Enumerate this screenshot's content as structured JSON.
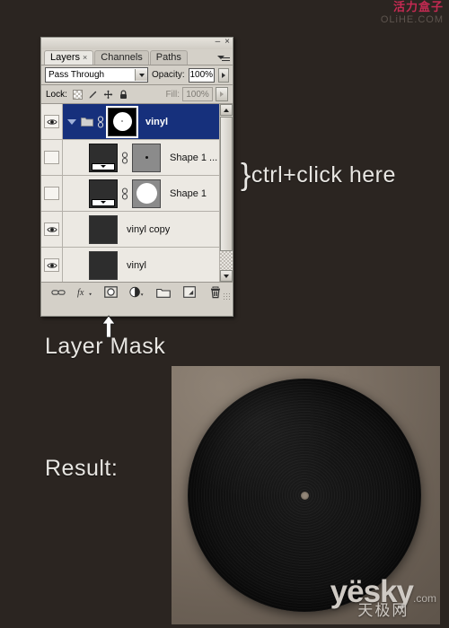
{
  "watermarks": {
    "top": {
      "cn": "活力盒子",
      "en": "OLiHE.COM"
    },
    "bottom": {
      "main": "yësky",
      "suffix": ".com",
      "cn": "天极网"
    }
  },
  "panel": {
    "window_controls": {
      "minimize": "–",
      "close": "×"
    },
    "menu_icon": "panel-menu-icon",
    "tabs": [
      {
        "label": "Layers",
        "close": "×",
        "active": true
      },
      {
        "label": "Channels",
        "active": false
      },
      {
        "label": "Paths",
        "active": false
      }
    ],
    "blend_mode": {
      "value": "Pass Through",
      "arrow": "▼"
    },
    "opacity": {
      "label": "Opacity:",
      "value": "100%",
      "stepper": "▶"
    },
    "lock": {
      "label": "Lock:",
      "icons": [
        "lock-transparency-icon",
        "lock-image-icon",
        "lock-position-icon",
        "lock-all-icon"
      ]
    },
    "fill": {
      "label": "Fill:",
      "value": "100%",
      "stepper": "▶"
    },
    "layers": [
      {
        "name": "vinyl",
        "visible": true,
        "selected": true,
        "type": "group",
        "expanded": true,
        "linked": true,
        "has_mask": true,
        "mask_selected": true
      },
      {
        "name": "Shape 1 ...",
        "visible": false,
        "selected": false,
        "type": "shape",
        "linked": true,
        "has_mask": true,
        "mask_kind": "dot"
      },
      {
        "name": "Shape 1",
        "visible": false,
        "selected": false,
        "type": "shape",
        "linked": true,
        "has_mask": true,
        "mask_kind": "circle"
      },
      {
        "name": "vinyl copy",
        "visible": true,
        "selected": false,
        "type": "raster",
        "linked": false,
        "has_mask": false
      },
      {
        "name": "vinyl",
        "visible": true,
        "selected": false,
        "type": "raster",
        "linked": false,
        "has_mask": false
      }
    ],
    "scrollbar": {
      "up": "▲",
      "down": "▼"
    },
    "toolbar": [
      {
        "name": "link-layers-icon",
        "glyph": "link"
      },
      {
        "name": "layer-style-fx-icon",
        "glyph": "fx"
      },
      {
        "name": "add-layer-mask-icon",
        "glyph": "mask"
      },
      {
        "name": "new-adjustment-layer-icon",
        "glyph": "adjust"
      },
      {
        "name": "new-group-icon",
        "glyph": "folder"
      },
      {
        "name": "new-layer-icon",
        "glyph": "newlayer"
      },
      {
        "name": "delete-layer-icon",
        "glyph": "trash"
      }
    ]
  },
  "annotations": {
    "ctrl_click": {
      "brace": "}",
      "text": "ctrl+click here"
    },
    "layer_mask": "Layer Mask",
    "result": "Result:"
  },
  "colors": {
    "background": "#2b2521",
    "panel_bg": "#d4d0c8",
    "layer_selected": "#16307c",
    "accent_red": "#c42a52",
    "photo_bg": "#7e7266",
    "record": "#121212"
  }
}
